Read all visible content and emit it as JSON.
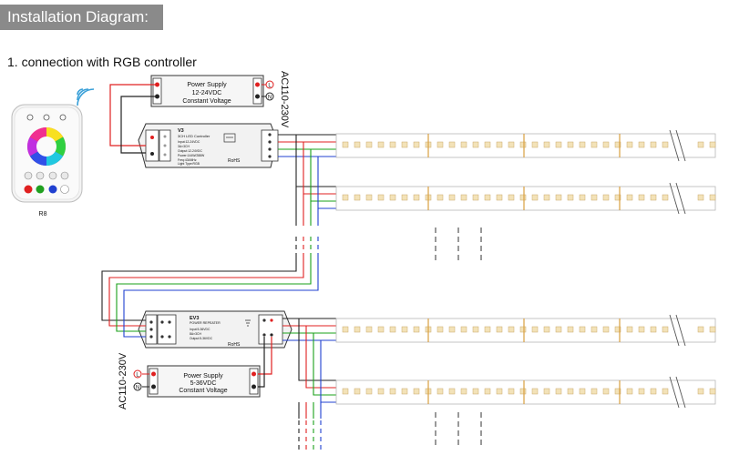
{
  "header": {
    "title": "Installation Diagram:"
  },
  "section": {
    "heading": "1. connection with RGB controller"
  },
  "remote": {
    "label": "R8"
  },
  "power_supply_top": {
    "line1": "Power Supply",
    "line2": "12-24VDC",
    "line3": "Constant Voltage",
    "ac_label": "AC110-230V",
    "l_label": "L",
    "n_label": "N"
  },
  "controller": {
    "model": "V3",
    "title": "3CH LED Controller",
    "spec1": "Input:12-24VDC",
    "spec2": "3A×3CH",
    "spec3": "Output:12-24VDC",
    "spec4": "Power:144W/288W",
    "spec5": "Freq:434MHz",
    "spec6": "Light Type:RGB",
    "rohs": "RoHS"
  },
  "amplifier": {
    "model": "EV3",
    "title": "POWER REPEATER",
    "spec1": "Input:5-36VDC",
    "spec2": "8A×3CH",
    "spec3": "Output:5-36VDC",
    "rohs": "RoHS"
  },
  "power_supply_bottom": {
    "line1": "Power Supply",
    "line2": "5-36VDC",
    "line3": "Constant Voltage",
    "ac_label": "AC110-230V",
    "l_label": "L",
    "n_label": "N"
  },
  "colors": {
    "wire_red": "#e02020",
    "wire_green": "#1aa01a",
    "wire_blue": "#2040d0",
    "wire_black": "#222222",
    "header_bg": "#8a8a8a",
    "strip_edge": "#c9c9c9"
  },
  "icons": [
    "wifi-signal-icon",
    "rgb-color-wheel-icon",
    "led-chip-icon",
    "ground-icon"
  ]
}
